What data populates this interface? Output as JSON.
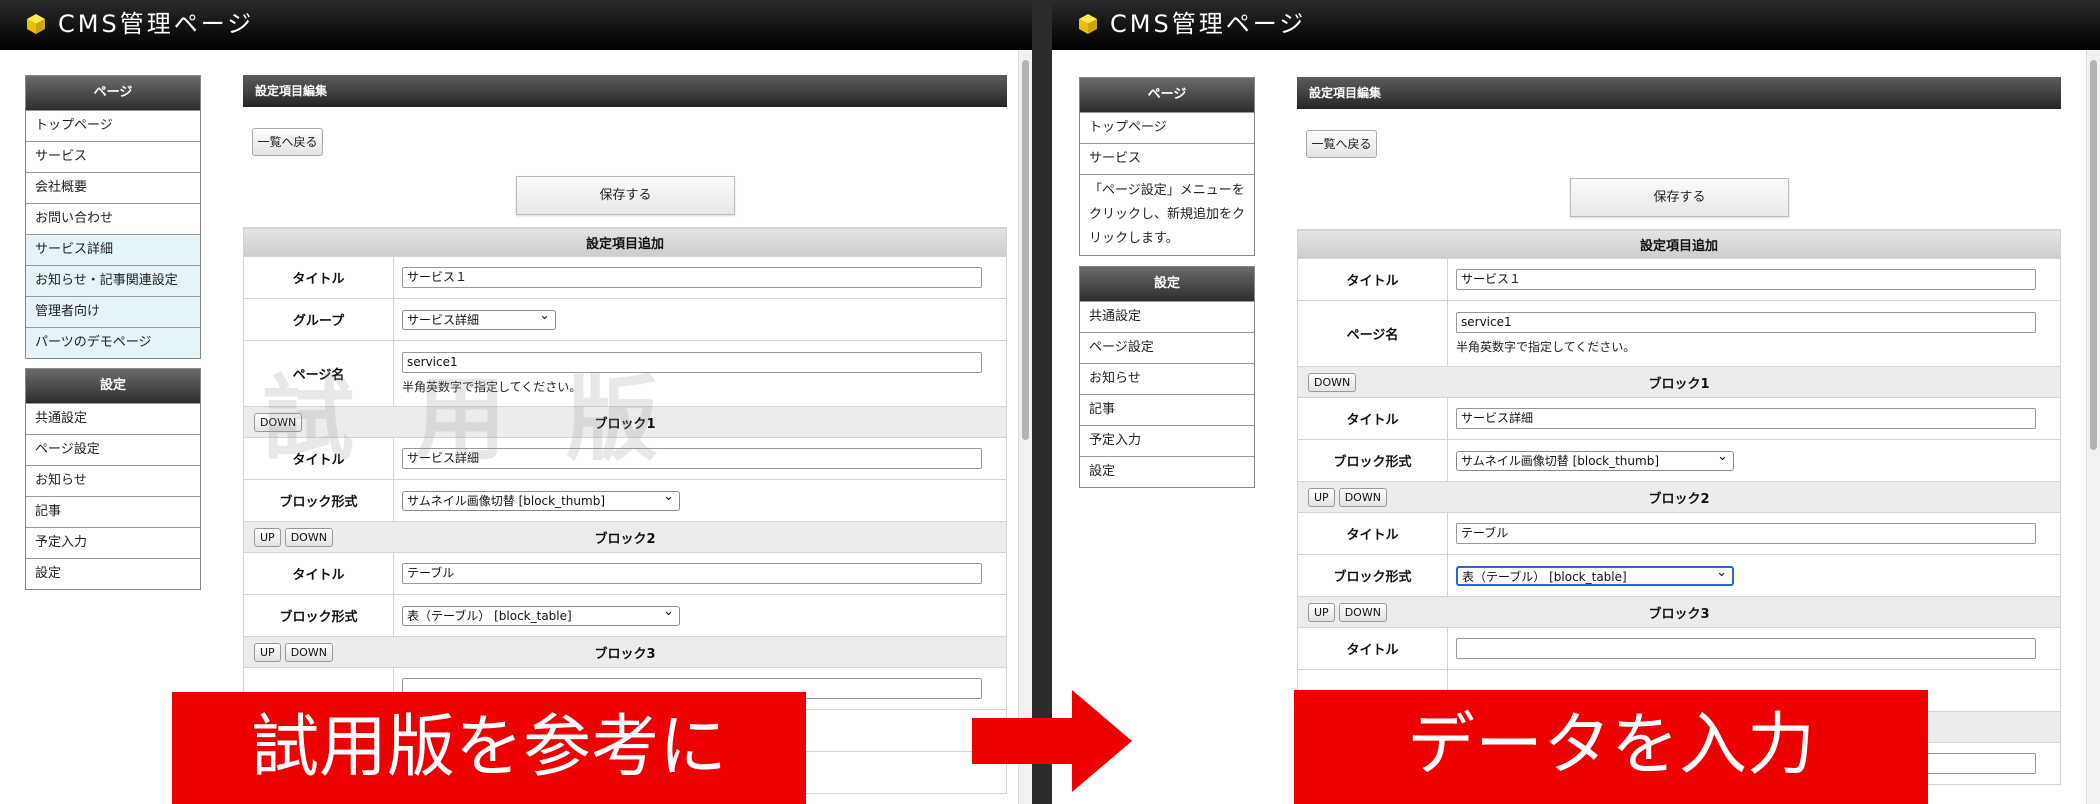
{
  "left": {
    "app_title": "CMS管理ページ",
    "sidebar": {
      "page_header": "ページ",
      "page_items": [
        "トップページ",
        "サービス",
        "会社概要",
        "お問い合わせ",
        "サービス詳細",
        "お知らせ・記事関連設定",
        "管理者向け",
        "パーツのデモページ"
      ],
      "settings_header": "設定",
      "settings_items": [
        "共通設定",
        "ページ設定",
        "お知らせ",
        "記事",
        "予定入力",
        "設定"
      ]
    },
    "main": {
      "header": "設定項目編集",
      "back_button": "一覧へ戻る",
      "save_button": "保存する",
      "section_header": "設定項目追加",
      "title_label": "タイトル",
      "title_value": "サービス１",
      "group_label": "グループ",
      "group_value": "サービス詳細",
      "page_name_label": "ページ名",
      "page_name_value": "service1",
      "page_name_hint": "半角英数字で指定してください。",
      "watermark": "試用版",
      "blocks": [
        {
          "name": "ブロック1",
          "up": "",
          "down": "DOWN",
          "title_label": "タイトル",
          "title_value": "サービス詳細",
          "format_label": "ブロック形式",
          "format_value": "サムネイル画像切替 [block_thumb]"
        },
        {
          "name": "ブロック2",
          "up": "UP",
          "down": "DOWN",
          "title_label": "タイトル",
          "title_value": "テーブル",
          "format_label": "ブロック形式",
          "format_value": "表（テーブル） [block_table]"
        },
        {
          "name": "ブロック3",
          "up": "UP",
          "down": "DOWN"
        }
      ]
    },
    "banner": "試用版を参考に"
  },
  "right": {
    "app_title": "CMS管理ページ",
    "sidebar": {
      "page_header": "ページ",
      "page_items": [
        "トップページ",
        "サービス"
      ],
      "page_note": "「ページ設定」メニューをクリックし、新規追加をクリックします。",
      "settings_header": "設定",
      "settings_items": [
        "共通設定",
        "ページ設定",
        "お知らせ",
        "記事",
        "予定入力",
        "設定"
      ]
    },
    "main": {
      "header": "設定項目編集",
      "back_button": "一覧へ戻る",
      "save_button": "保存する",
      "section_header": "設定項目追加",
      "title_label": "タイトル",
      "title_value": "サービス１",
      "page_name_label": "ページ名",
      "page_name_value": "service1",
      "page_name_hint": "半角英数字で指定してください。",
      "blocks": [
        {
          "name": "ブロック1",
          "up": "",
          "down": "DOWN",
          "title_label": "タイトル",
          "title_value": "サービス詳細",
          "format_label": "ブロック形式",
          "format_value": "サムネイル画像切替 [block_thumb]"
        },
        {
          "name": "ブロック2",
          "up": "UP",
          "down": "DOWN",
          "title_label": "タイトル",
          "title_value": "テーブル",
          "format_label": "ブロック形式",
          "format_value": "表（テーブル） [block_table]"
        },
        {
          "name": "ブロック3",
          "up": "UP",
          "down": "DOWN",
          "title_label": "タイトル",
          "title_value": ""
        }
      ]
    },
    "banner": "データを入力"
  },
  "colors": {
    "banner_red": "#ee0000",
    "focus_blue": "#2a62d8",
    "highlight_row": "#e4f4f9",
    "logo_yellow": "#f2d400"
  }
}
